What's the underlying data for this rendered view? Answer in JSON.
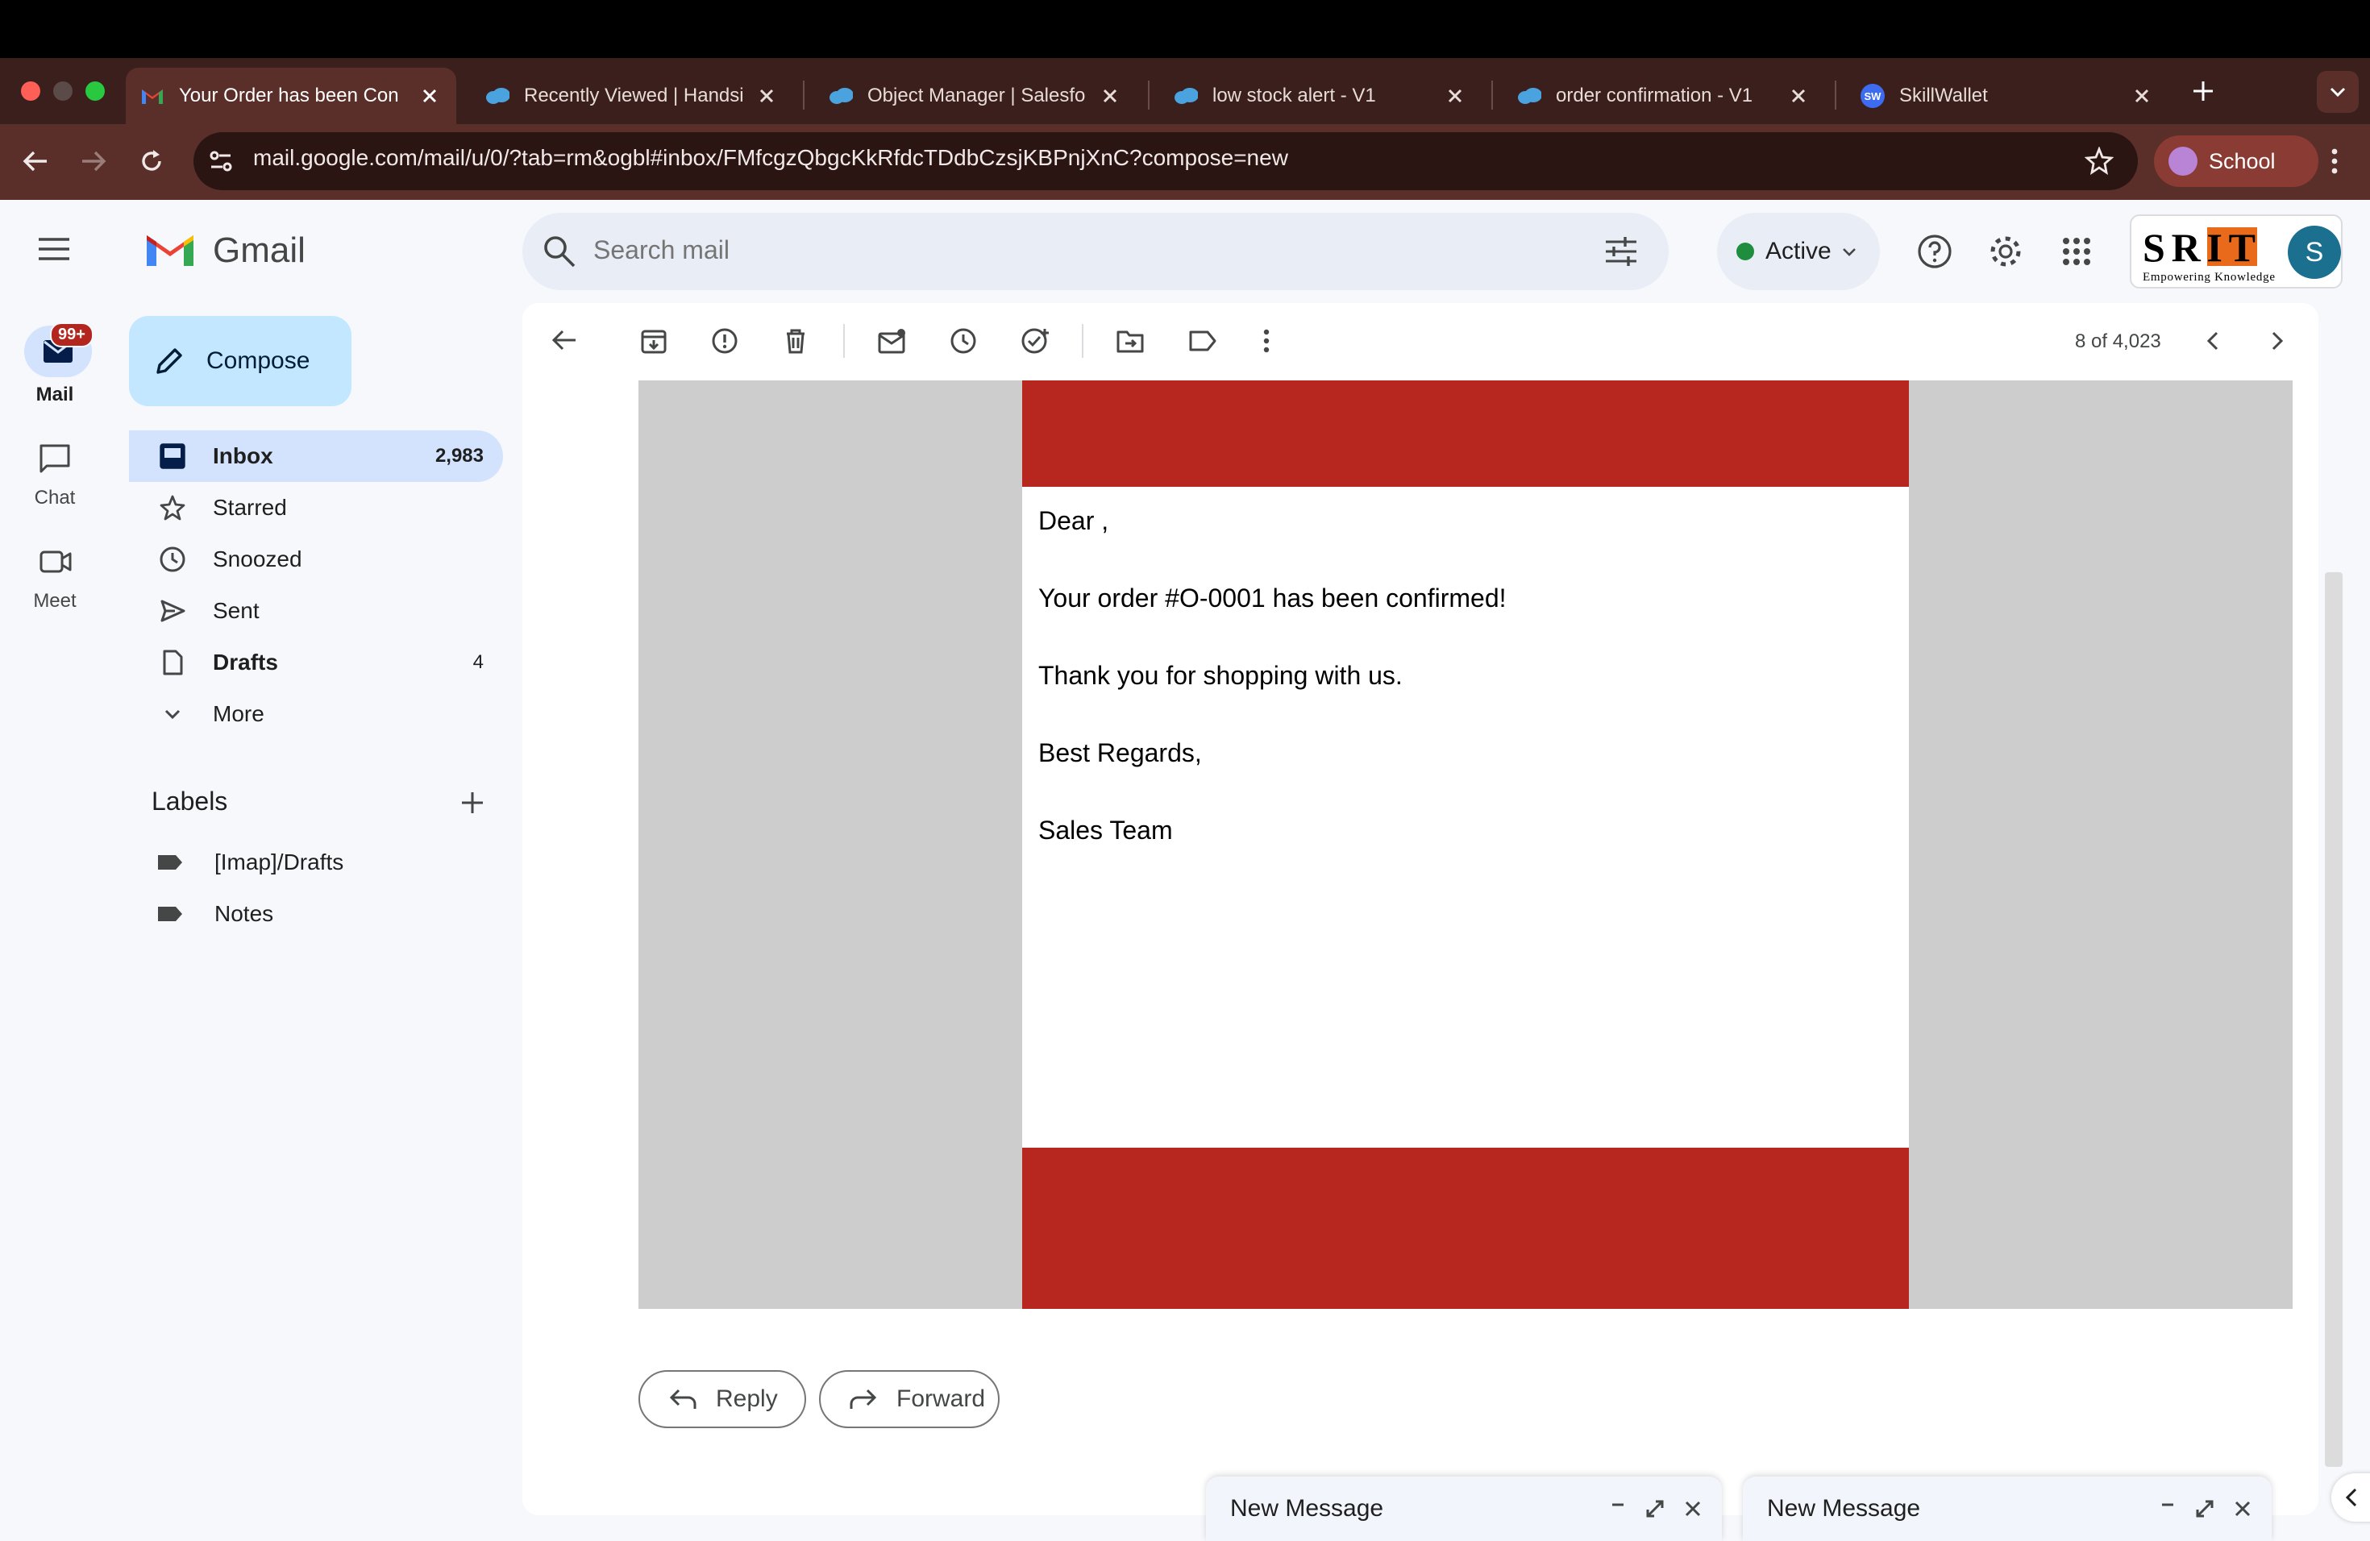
{
  "browser": {
    "tabs": [
      {
        "title": "Your Order has been Con",
        "icon": "gmail-icon",
        "active": true
      },
      {
        "title": "Recently Viewed | Handsi",
        "icon": "salesforce-cloud-icon"
      },
      {
        "title": "Object Manager | Salesfo",
        "icon": "salesforce-cloud-icon"
      },
      {
        "title": "low stock alert - V1",
        "icon": "salesforce-cloud-icon"
      },
      {
        "title": "order confirmation - V1",
        "icon": "salesforce-cloud-icon"
      },
      {
        "title": "SkillWallet",
        "icon": "skillwallet-icon"
      }
    ],
    "favicon_sw_text": "SW",
    "url": "mail.google.com/mail/u/0/?tab=rm&ogbl#inbox/FMfcgzQbgcKkRfdcTDdbCzsjKBPnjXnC?compose=new",
    "profile_label": "School"
  },
  "gmail": {
    "app_name": "Gmail",
    "search_placeholder": "Search mail",
    "status": "Active",
    "status_color": "#1e8e3e",
    "avatar_letter": "S",
    "brand_logo": {
      "main": "SRIT",
      "tagline": "Empowering Knowledge"
    },
    "rail": [
      {
        "label": "Mail",
        "badge": "99+"
      },
      {
        "label": "Chat"
      },
      {
        "label": "Meet"
      }
    ],
    "compose_label": "Compose",
    "nav": [
      {
        "label": "Inbox",
        "count": "2,983"
      },
      {
        "label": "Starred",
        "count": ""
      },
      {
        "label": "Snoozed",
        "count": ""
      },
      {
        "label": "Sent",
        "count": ""
      },
      {
        "label": "Drafts",
        "count": "4"
      },
      {
        "label": "More",
        "count": ""
      }
    ],
    "labels_heading": "Labels",
    "labels": [
      "[Imap]/Drafts",
      "Notes"
    ],
    "pagination": "8 of 4,023"
  },
  "email": {
    "lines": [
      "Dear ,",
      "Your order #O-0001 has been confirmed!",
      "Thank you for shopping with us.",
      "Best Regards,",
      "Sales Team"
    ],
    "band_color": "#b8271f"
  },
  "actions": {
    "reply": "Reply",
    "forward": "Forward"
  },
  "compose_windows": [
    "New Message",
    "New Message"
  ]
}
